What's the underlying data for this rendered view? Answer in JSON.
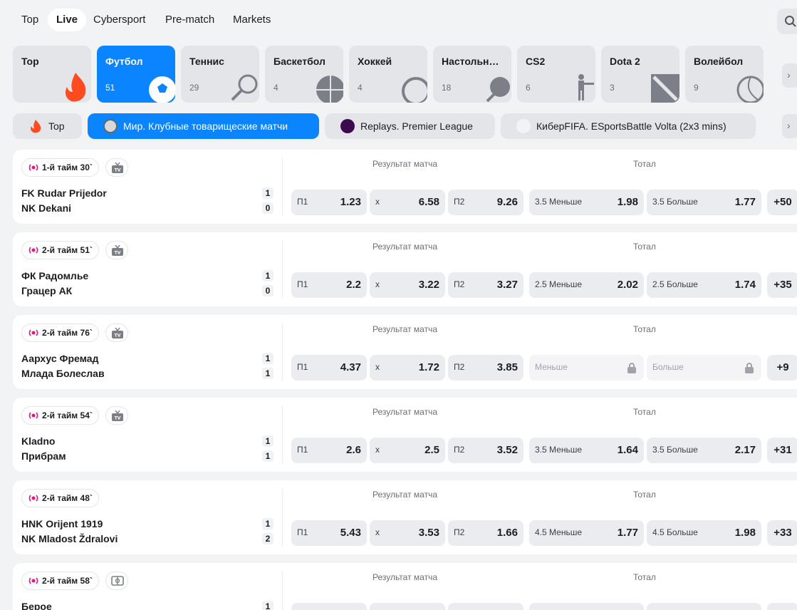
{
  "nav": {
    "tabs": [
      {
        "label": "Top"
      },
      {
        "label": "Live"
      },
      {
        "label": "Cybersport"
      },
      {
        "label": "Pre-match"
      },
      {
        "label": "Markets"
      }
    ],
    "active": "Live"
  },
  "sports": [
    {
      "name": "Top",
      "count": "",
      "icon": "fire-icon"
    },
    {
      "name": "Футбол",
      "count": "51",
      "icon": "soccer-ball-icon"
    },
    {
      "name": "Теннис",
      "count": "29",
      "icon": "tennis-racket-icon"
    },
    {
      "name": "Баскетбол",
      "count": "4",
      "icon": "basketball-icon"
    },
    {
      "name": "Хоккей",
      "count": "4",
      "icon": "hockey-puck-icon"
    },
    {
      "name": "Настольн…",
      "count": "18",
      "icon": "table-tennis-icon"
    },
    {
      "name": "CS2",
      "count": "6",
      "icon": "soldier-icon"
    },
    {
      "name": "Dota 2",
      "count": "3",
      "icon": "dota-logo-icon"
    },
    {
      "name": "Волейбол",
      "count": "9",
      "icon": "volleyball-icon"
    }
  ],
  "leagues": [
    {
      "label": "Top",
      "icon": "fire-icon"
    },
    {
      "label": "Мир. Клубные товарищеские матчи",
      "icon": "globe-emblem-icon"
    },
    {
      "label": "Replays. Premier League",
      "icon": "premier-league-icon"
    },
    {
      "label": "КиберFIFA. ESportsBattle Volta (2x3 mins)",
      "icon": "esports-battle-icon"
    }
  ],
  "headers": {
    "result": "Результат матча",
    "total": "Тотал"
  },
  "matches": [
    {
      "status": "1-й тайм 30`",
      "media": "tv",
      "home": "FK Rudar Prijedor",
      "away": "NK Dekani",
      "home_score": "1",
      "away_score": "0",
      "p1": "1.23",
      "x": "6.58",
      "p2": "9.26",
      "under_label": "3.5 Меньше",
      "under": "1.98",
      "over_label": "3.5 Больше",
      "over": "1.77",
      "more": "+50",
      "locked": false
    },
    {
      "status": "2-й тайм 51`",
      "media": "tv",
      "home": "ФК Радомлье",
      "away": "Грацер АК",
      "home_score": "1",
      "away_score": "0",
      "p1": "2.2",
      "x": "3.22",
      "p2": "3.27",
      "under_label": "2.5 Меньше",
      "under": "2.02",
      "over_label": "2.5 Больше",
      "over": "1.74",
      "more": "+35",
      "locked": false
    },
    {
      "status": "2-й тайм 76`",
      "media": "tv",
      "home": "Аархус Фремад",
      "away": "Млада Болеслав",
      "home_score": "1",
      "away_score": "1",
      "p1": "4.37",
      "x": "1.72",
      "p2": "3.85",
      "under_label": "Меньше",
      "under": "",
      "over_label": "Больше",
      "over": "",
      "more": "+9",
      "locked": true
    },
    {
      "status": "2-й тайм 54`",
      "media": "tv",
      "home": "Kladno",
      "away": "Прибрам",
      "home_score": "1",
      "away_score": "1",
      "p1": "2.6",
      "x": "2.5",
      "p2": "3.52",
      "under_label": "3.5 Меньше",
      "under": "1.64",
      "over_label": "3.5 Больше",
      "over": "2.17",
      "more": "+31",
      "locked": false
    },
    {
      "status": "2-й тайм 48`",
      "media": "none",
      "home": "HNK Orijent 1919",
      "away": "NK Mladost Ždralovi",
      "home_score": "1",
      "away_score": "2",
      "p1": "5.43",
      "x": "3.53",
      "p2": "1.66",
      "under_label": "4.5 Меньше",
      "under": "1.77",
      "over_label": "4.5 Больше",
      "over": "1.98",
      "more": "+33",
      "locked": false
    },
    {
      "status": "2-й тайм 58`",
      "media": "field",
      "home": "Берое",
      "away": "",
      "home_score": "1",
      "away_score": "",
      "p1": "",
      "x": "",
      "p2": "",
      "under_label": "",
      "under": "",
      "over_label": "",
      "over": "",
      "more": "",
      "locked": false
    }
  ],
  "odds_labels": {
    "p1": "П1",
    "x": "х",
    "p2": "П2"
  },
  "colors": {
    "accent": "#0a84ff",
    "live": "#e5177e",
    "fire": "#ff4b1f"
  }
}
